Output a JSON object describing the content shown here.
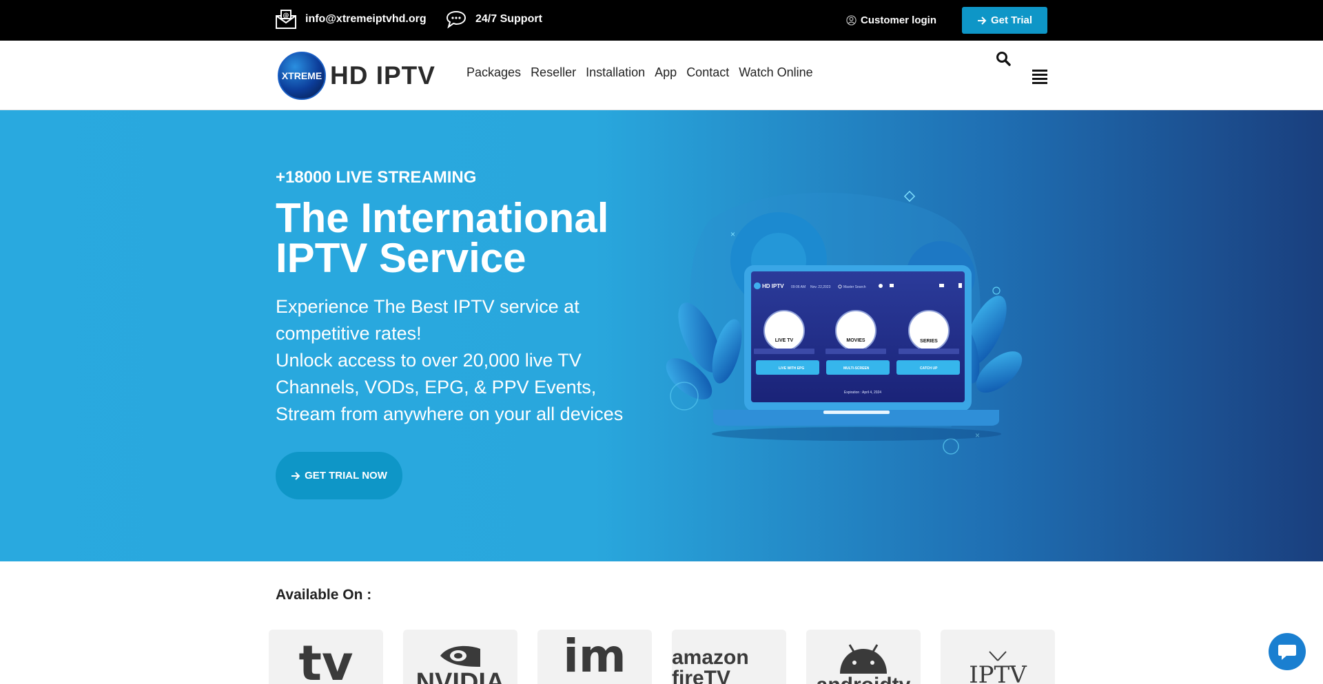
{
  "topbar": {
    "email": "info@xtremeiptvhd.org",
    "support": "24/7 Support",
    "login": "Customer login",
    "trial": "Get Trial"
  },
  "header": {
    "logo_mark": "XTREME",
    "logo_text": "HD IPTV",
    "nav": [
      "Packages",
      "Reseller",
      "Installation",
      "App",
      "Contact",
      "Watch Online"
    ]
  },
  "hero": {
    "kicker": "+18000 LIVE STREAMING",
    "title": "The International IPTV Service",
    "desc_lines": [
      "Experience The Best IPTV service at competitive rates!",
      "Unlock access to over 20,000 live TV Channels, VODs, EPG, & PPV Events, Stream from anywhere on your all devices"
    ],
    "cta": "GET TRIAL NOW",
    "screen": {
      "brand": "HD IPTV",
      "time": "09:06 AM",
      "date": "Nov. 22,2023",
      "search": "Master Search",
      "tiles": [
        "LIVE TV",
        "MOVIES",
        "SERIES"
      ],
      "buttons": [
        "LIVE WITH EPG",
        "MULTI-SCREEN",
        "CATCH UP"
      ],
      "expiration": "Expiration : April 4, 2024"
    }
  },
  "available": {
    "heading": "Available On :",
    "platforms": [
      "tv",
      "NVIDIA",
      "im",
      "amazon fireTV",
      "androidtv",
      "IPTV"
    ]
  },
  "colors": {
    "accent": "#0e96c7",
    "hero_start": "#29a9df",
    "hero_end": "#1a3f7e"
  }
}
